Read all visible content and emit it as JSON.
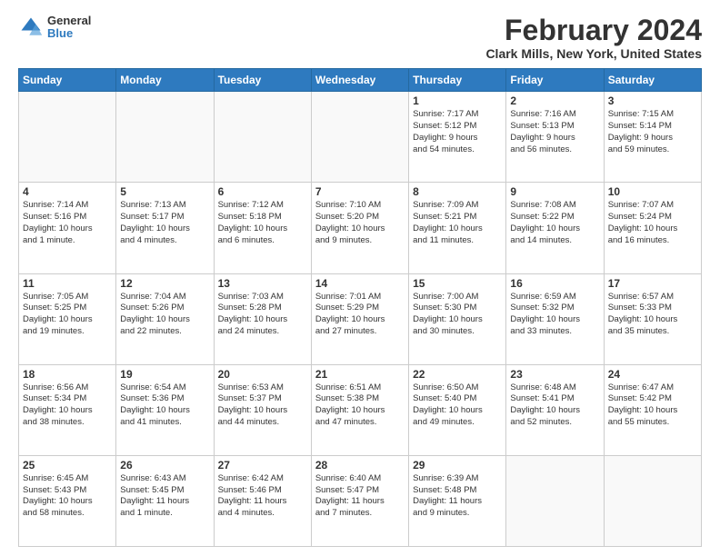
{
  "header": {
    "logo": {
      "general": "General",
      "blue": "Blue"
    },
    "title": "February 2024",
    "location": "Clark Mills, New York, United States"
  },
  "weekdays": [
    "Sunday",
    "Monday",
    "Tuesday",
    "Wednesday",
    "Thursday",
    "Friday",
    "Saturday"
  ],
  "weeks": [
    [
      {
        "day": "",
        "info": ""
      },
      {
        "day": "",
        "info": ""
      },
      {
        "day": "",
        "info": ""
      },
      {
        "day": "",
        "info": ""
      },
      {
        "day": "1",
        "info": "Sunrise: 7:17 AM\nSunset: 5:12 PM\nDaylight: 9 hours\nand 54 minutes."
      },
      {
        "day": "2",
        "info": "Sunrise: 7:16 AM\nSunset: 5:13 PM\nDaylight: 9 hours\nand 56 minutes."
      },
      {
        "day": "3",
        "info": "Sunrise: 7:15 AM\nSunset: 5:14 PM\nDaylight: 9 hours\nand 59 minutes."
      }
    ],
    [
      {
        "day": "4",
        "info": "Sunrise: 7:14 AM\nSunset: 5:16 PM\nDaylight: 10 hours\nand 1 minute."
      },
      {
        "day": "5",
        "info": "Sunrise: 7:13 AM\nSunset: 5:17 PM\nDaylight: 10 hours\nand 4 minutes."
      },
      {
        "day": "6",
        "info": "Sunrise: 7:12 AM\nSunset: 5:18 PM\nDaylight: 10 hours\nand 6 minutes."
      },
      {
        "day": "7",
        "info": "Sunrise: 7:10 AM\nSunset: 5:20 PM\nDaylight: 10 hours\nand 9 minutes."
      },
      {
        "day": "8",
        "info": "Sunrise: 7:09 AM\nSunset: 5:21 PM\nDaylight: 10 hours\nand 11 minutes."
      },
      {
        "day": "9",
        "info": "Sunrise: 7:08 AM\nSunset: 5:22 PM\nDaylight: 10 hours\nand 14 minutes."
      },
      {
        "day": "10",
        "info": "Sunrise: 7:07 AM\nSunset: 5:24 PM\nDaylight: 10 hours\nand 16 minutes."
      }
    ],
    [
      {
        "day": "11",
        "info": "Sunrise: 7:05 AM\nSunset: 5:25 PM\nDaylight: 10 hours\nand 19 minutes."
      },
      {
        "day": "12",
        "info": "Sunrise: 7:04 AM\nSunset: 5:26 PM\nDaylight: 10 hours\nand 22 minutes."
      },
      {
        "day": "13",
        "info": "Sunrise: 7:03 AM\nSunset: 5:28 PM\nDaylight: 10 hours\nand 24 minutes."
      },
      {
        "day": "14",
        "info": "Sunrise: 7:01 AM\nSunset: 5:29 PM\nDaylight: 10 hours\nand 27 minutes."
      },
      {
        "day": "15",
        "info": "Sunrise: 7:00 AM\nSunset: 5:30 PM\nDaylight: 10 hours\nand 30 minutes."
      },
      {
        "day": "16",
        "info": "Sunrise: 6:59 AM\nSunset: 5:32 PM\nDaylight: 10 hours\nand 33 minutes."
      },
      {
        "day": "17",
        "info": "Sunrise: 6:57 AM\nSunset: 5:33 PM\nDaylight: 10 hours\nand 35 minutes."
      }
    ],
    [
      {
        "day": "18",
        "info": "Sunrise: 6:56 AM\nSunset: 5:34 PM\nDaylight: 10 hours\nand 38 minutes."
      },
      {
        "day": "19",
        "info": "Sunrise: 6:54 AM\nSunset: 5:36 PM\nDaylight: 10 hours\nand 41 minutes."
      },
      {
        "day": "20",
        "info": "Sunrise: 6:53 AM\nSunset: 5:37 PM\nDaylight: 10 hours\nand 44 minutes."
      },
      {
        "day": "21",
        "info": "Sunrise: 6:51 AM\nSunset: 5:38 PM\nDaylight: 10 hours\nand 47 minutes."
      },
      {
        "day": "22",
        "info": "Sunrise: 6:50 AM\nSunset: 5:40 PM\nDaylight: 10 hours\nand 49 minutes."
      },
      {
        "day": "23",
        "info": "Sunrise: 6:48 AM\nSunset: 5:41 PM\nDaylight: 10 hours\nand 52 minutes."
      },
      {
        "day": "24",
        "info": "Sunrise: 6:47 AM\nSunset: 5:42 PM\nDaylight: 10 hours\nand 55 minutes."
      }
    ],
    [
      {
        "day": "25",
        "info": "Sunrise: 6:45 AM\nSunset: 5:43 PM\nDaylight: 10 hours\nand 58 minutes."
      },
      {
        "day": "26",
        "info": "Sunrise: 6:43 AM\nSunset: 5:45 PM\nDaylight: 11 hours\nand 1 minute."
      },
      {
        "day": "27",
        "info": "Sunrise: 6:42 AM\nSunset: 5:46 PM\nDaylight: 11 hours\nand 4 minutes."
      },
      {
        "day": "28",
        "info": "Sunrise: 6:40 AM\nSunset: 5:47 PM\nDaylight: 11 hours\nand 7 minutes."
      },
      {
        "day": "29",
        "info": "Sunrise: 6:39 AM\nSunset: 5:48 PM\nDaylight: 11 hours\nand 9 minutes."
      },
      {
        "day": "",
        "info": ""
      },
      {
        "day": "",
        "info": ""
      }
    ]
  ]
}
